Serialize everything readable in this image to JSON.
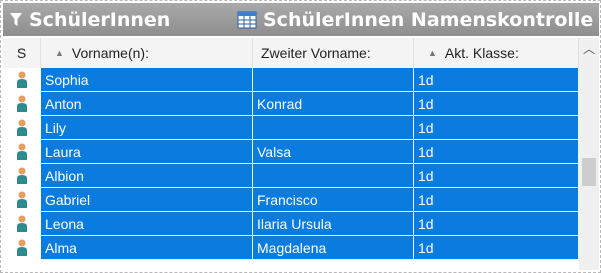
{
  "tabs": [
    {
      "label": "SchülerInnen",
      "icon": "filter-icon"
    },
    {
      "label": "SchülerInnen Namenskontrolle",
      "icon": "table-icon"
    }
  ],
  "columns": {
    "status": "S",
    "vorname": "Vorname(n):",
    "zweiter": "Zweiter Vorname:",
    "klasse": "Akt. Klasse:"
  },
  "rows": [
    {
      "vorname": "Sophia",
      "zweiter": "",
      "klasse": "1d"
    },
    {
      "vorname": "Anton",
      "zweiter": "Konrad",
      "klasse": "1d"
    },
    {
      "vorname": "Lily",
      "zweiter": "",
      "klasse": "1d"
    },
    {
      "vorname": "Laura",
      "zweiter": "Valsa",
      "klasse": "1d"
    },
    {
      "vorname": "Albion",
      "zweiter": "",
      "klasse": "1d"
    },
    {
      "vorname": "Gabriel",
      "zweiter": "Francisco",
      "klasse": "1d"
    },
    {
      "vorname": "Leona",
      "zweiter": "Ilaria Ursula",
      "klasse": "1d"
    },
    {
      "vorname": "Alma",
      "zweiter": "Magdalena",
      "klasse": "1d"
    }
  ],
  "row_icon": "student-icon",
  "colors": {
    "selection": "#0a7ce0",
    "titlebar": "#9a9a9a",
    "student_body": "#2f8a8f",
    "student_head": "#e0a060"
  }
}
